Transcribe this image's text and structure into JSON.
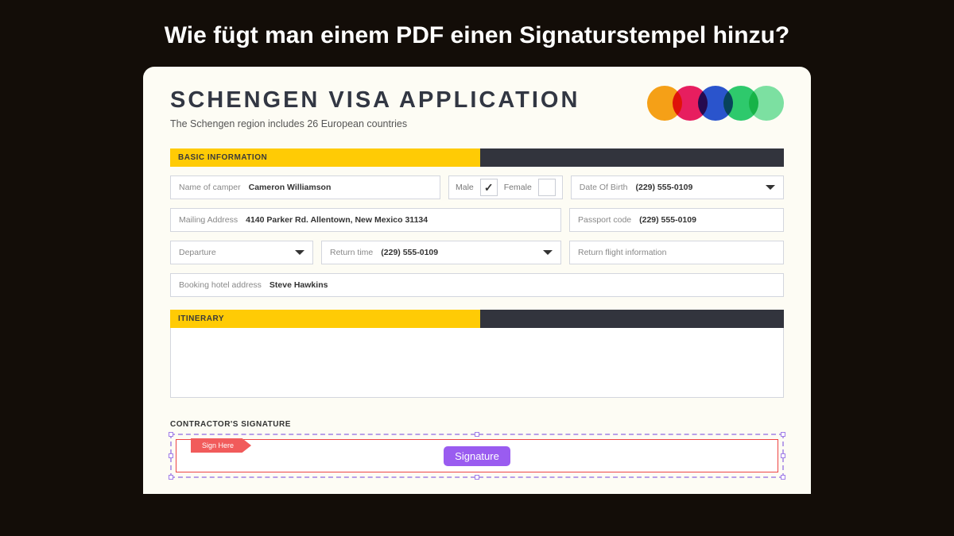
{
  "pageTitle": "Wie fügt man einem PDF einen Signaturstempel hinzu?",
  "doc": {
    "title": "SCHENGEN VISA APPLICATION",
    "subtitle": "The Schengen region includes 26 European countries"
  },
  "sections": {
    "basic": "BASIC INFORMATION",
    "itinerary": "ITINERARY",
    "signature": "CONTRACTOR'S SIGNATURE"
  },
  "fields": {
    "nameLabel": "Name of camper",
    "nameValue": "Cameron Williamson",
    "male": "Male",
    "female": "Female",
    "dobLabel": "Date Of Birth",
    "dobValue": "(229) 555-0109",
    "mailLabel": "Mailing Address",
    "mailValue": "4140 Parker Rd. Allentown, New Mexico 31134",
    "passportLabel": "Passport code",
    "passportValue": "(229) 555-0109",
    "departure": "Departure",
    "returnTimeLabel": "Return time",
    "returnTimeValue": "(229) 555-0109",
    "returnFlight": "Return flight information",
    "bookingLabel": "Booking hotel address",
    "bookingValue": "Steve Hawkins"
  },
  "signature": {
    "signHere": "Sign Here",
    "button": "Signature"
  }
}
